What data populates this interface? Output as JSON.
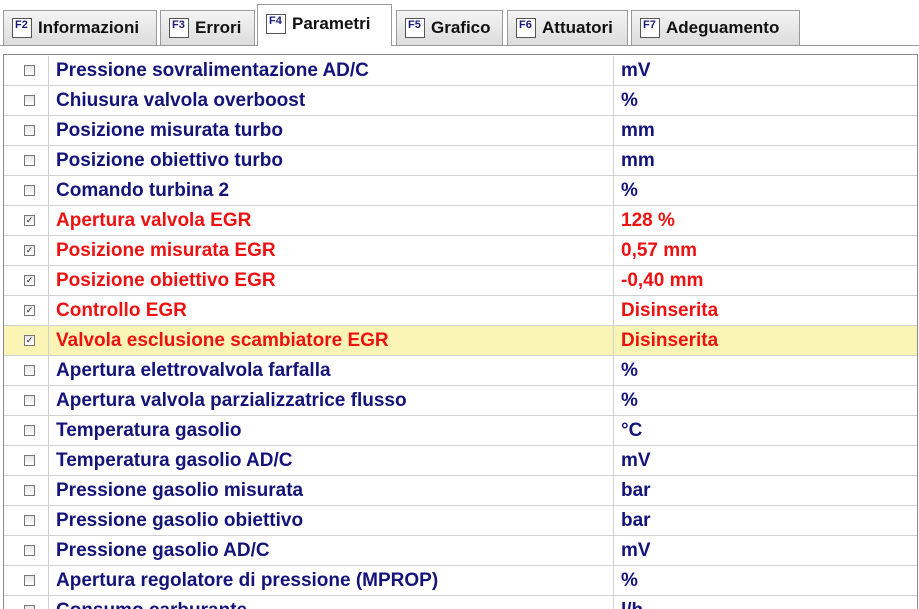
{
  "tabs": [
    {
      "key": "F2",
      "label": "Informazioni"
    },
    {
      "key": "F3",
      "label": "Errori"
    },
    {
      "key": "F4",
      "label": "Parametri"
    },
    {
      "key": "F5",
      "label": "Grafico"
    },
    {
      "key": "F6",
      "label": "Attuatori"
    },
    {
      "key": "F7",
      "label": "Adeguamento"
    }
  ],
  "active_tab": "Parametri",
  "colors": {
    "normal_text": "#13137a",
    "selected_text": "#ee1111",
    "highlight_row": "#faf5b4"
  },
  "rows": [
    {
      "name": "Pressione sovralimentazione AD/C",
      "value": "mV",
      "checked": false
    },
    {
      "name": "Chiusura valvola overboost",
      "value": "%",
      "checked": false
    },
    {
      "name": "Posizione misurata turbo",
      "value": "mm",
      "checked": false
    },
    {
      "name": "Posizione obiettivo turbo",
      "value": "mm",
      "checked": false
    },
    {
      "name": "Comando turbina 2",
      "value": "%",
      "checked": false
    },
    {
      "name": "Apertura valvola EGR",
      "value": "128 %",
      "checked": true
    },
    {
      "name": "Posizione misurata EGR",
      "value": "0,57 mm",
      "checked": true
    },
    {
      "name": "Posizione obiettivo EGR",
      "value": "-0,40 mm",
      "checked": true
    },
    {
      "name": "Controllo EGR",
      "value": "Disinserita",
      "checked": true
    },
    {
      "name": "Valvola esclusione scambiatore EGR",
      "value": "Disinserita",
      "checked": true
    },
    {
      "name": "Apertura elettrovalvola farfalla",
      "value": "%",
      "checked": false
    },
    {
      "name": "Apertura valvola parzializzatrice flusso",
      "value": "%",
      "checked": false
    },
    {
      "name": "Temperatura gasolio",
      "value": "°C",
      "checked": false
    },
    {
      "name": "Temperatura gasolio AD/C",
      "value": "mV",
      "checked": false
    },
    {
      "name": "Pressione gasolio misurata",
      "value": "bar",
      "checked": false
    },
    {
      "name": "Pressione gasolio obiettivo",
      "value": "bar",
      "checked": false
    },
    {
      "name": "Pressione gasolio AD/C",
      "value": "mV",
      "checked": false
    },
    {
      "name": "Apertura regolatore di pressione (MPROP)",
      "value": "%",
      "checked": false
    },
    {
      "name": "Consumo carburante",
      "value": "l/h",
      "checked": false
    }
  ]
}
